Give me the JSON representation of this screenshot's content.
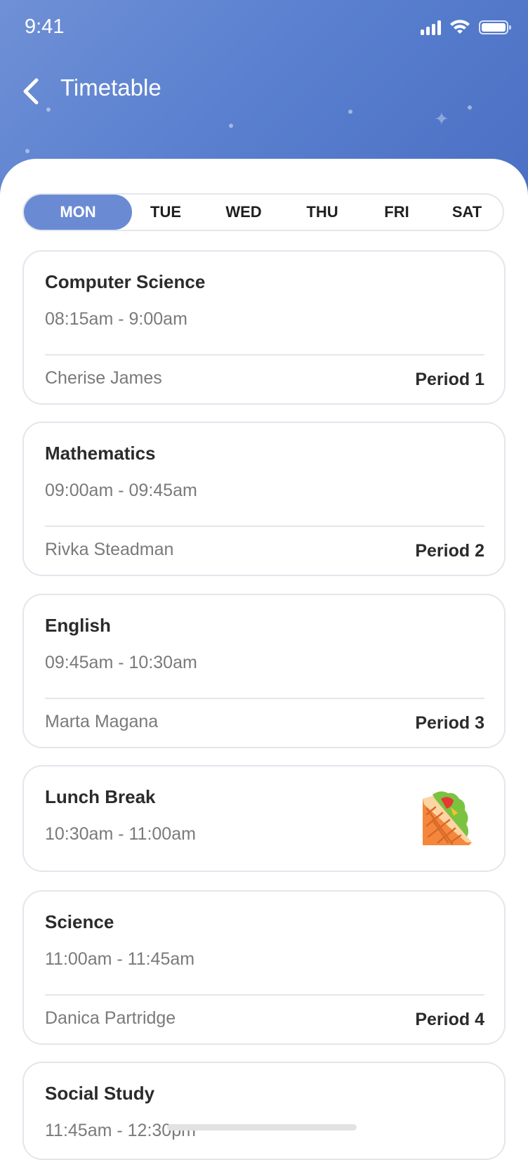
{
  "status_bar": {
    "time": "9:41"
  },
  "header": {
    "title": "Timetable"
  },
  "days": [
    {
      "label": "MON",
      "active": true
    },
    {
      "label": "TUE",
      "active": false
    },
    {
      "label": "WED",
      "active": false
    },
    {
      "label": "THU",
      "active": false
    },
    {
      "label": "FRI",
      "active": false
    },
    {
      "label": "SAT",
      "active": false
    }
  ],
  "classes": [
    {
      "subject": "Computer Science",
      "time": "08:15am - 9:00am",
      "teacher": "Cherise James",
      "period": "Period 1"
    },
    {
      "subject": "Mathematics",
      "time": "09:00am - 09:45am",
      "teacher": "Rivka Steadman",
      "period": "Period 2"
    },
    {
      "subject": "English",
      "time": "09:45am - 10:30am",
      "teacher": "Marta Magana",
      "period": "Period 3"
    },
    {
      "subject": "Lunch Break",
      "time": "10:30am - 11:00am",
      "icon": "sandwich-icon"
    },
    {
      "subject": "Science",
      "time": "11:00am - 11:45am",
      "teacher": "Danica Partridge",
      "period": "Period 4"
    },
    {
      "subject": "Social Study",
      "time": "11:45am - 12:30pm"
    }
  ],
  "colors": {
    "accent": "#6a8bd3",
    "header_start": "#6f90d6",
    "header_end": "#4a6fc4"
  }
}
